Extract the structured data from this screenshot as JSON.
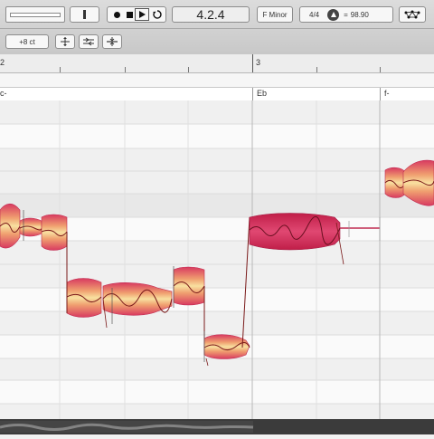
{
  "transport": {
    "position": "4.2.4",
    "key": "F Minor",
    "time_signature": "4/4",
    "tempo": "98.90"
  },
  "toolbar2": {
    "pitch_offset": "+8 ct"
  },
  "ruler": {
    "bar_start": "2",
    "bar_marker": "3"
  },
  "chords": [
    "c-",
    "Eb",
    "f-"
  ],
  "icons": {
    "record": "record-icon",
    "stop": "stop-icon",
    "play": "play-icon",
    "loop": "loop-icon",
    "metronome": "metronome-icon",
    "tool_a": "pitch-tool-icon",
    "tool_b": "formant-tool-icon",
    "tool_c": "center-pitch-tool-icon",
    "network": "network-icon"
  },
  "colors": {
    "blob_outer": "#d63a5f",
    "blob_inner": "#f7d48a",
    "blob_dark": "#c41f4a",
    "pitch_line": "#7a1a1a"
  }
}
